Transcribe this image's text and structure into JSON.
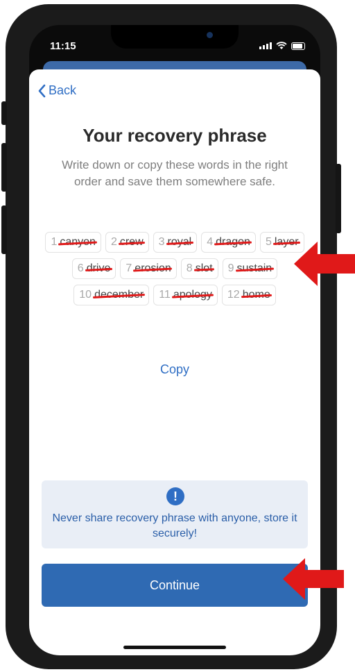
{
  "status_bar": {
    "time": "11:15"
  },
  "nav": {
    "back_label": "Back"
  },
  "header": {
    "title": "Your recovery phrase",
    "subtitle": "Write down or copy these words in the right order and save them somewhere safe."
  },
  "recovery_words": [
    {
      "index": "1",
      "word": "canyon"
    },
    {
      "index": "2",
      "word": "crew"
    },
    {
      "index": "3",
      "word": "royal"
    },
    {
      "index": "4",
      "word": "dragon"
    },
    {
      "index": "5",
      "word": "layer"
    },
    {
      "index": "6",
      "word": "drive"
    },
    {
      "index": "7",
      "word": "erosion"
    },
    {
      "index": "8",
      "word": "slot"
    },
    {
      "index": "9",
      "word": "sustain"
    },
    {
      "index": "10",
      "word": "december"
    },
    {
      "index": "11",
      "word": "apology"
    },
    {
      "index": "12",
      "word": "home"
    }
  ],
  "copy_label": "Copy",
  "warning": {
    "icon": "exclamation-icon",
    "text": "Never share recovery phrase with anyone, store it securely!"
  },
  "continue_label": "Continue",
  "colors": {
    "accent": "#2f6ec4",
    "button": "#2f6ab3",
    "warning_bg": "#e9eef6",
    "annotation_red": "#e01919"
  }
}
